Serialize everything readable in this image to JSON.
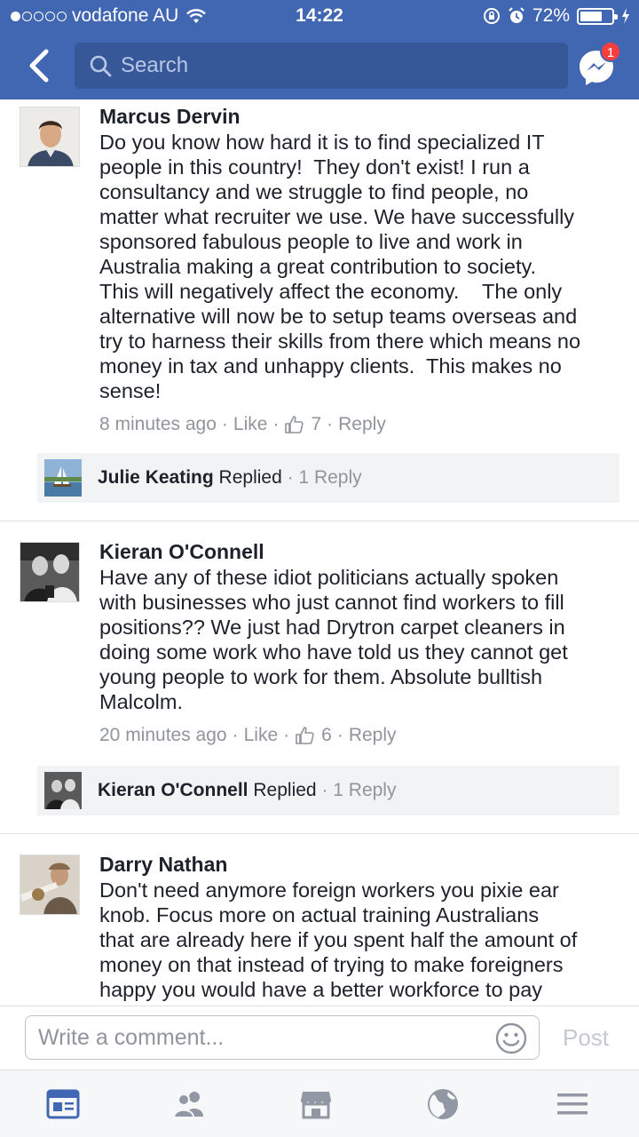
{
  "status_bar": {
    "carrier": "vodafone AU",
    "time": "14:22",
    "battery": "72%",
    "battery_level": 0.72,
    "signal_bars": 1
  },
  "header": {
    "search_placeholder": "Search",
    "messenger_badge": "1"
  },
  "comments": [
    {
      "author": "Marcus Dervin",
      "text": "Do you know how hard it is to find specialized IT\npeople in this country!  They don't exist! I run a\nconsultancy and we struggle to find people, no\nmatter what recruiter we use. We have successfully\nsponsored fabulous people to live and work in\nAustralia making a great contribution to society.\nThis will negatively affect the economy.    The only\nalternative will now be to setup teams overseas and\ntry to harness their skills from there which means no\nmoney in tax and unhappy clients.  This makes no\nsense!",
      "time": "8 minutes ago",
      "like_label": "Like",
      "like_count": "7",
      "reply_label": "Reply",
      "replied": {
        "name": "Julie Keating",
        "replied_label": "Replied",
        "count": "1 Reply"
      }
    },
    {
      "author": "Kieran O'Connell",
      "text": "Have any of these idiot politicians actually spoken\nwith businesses who just cannot find workers to fill\npositions?? We just had Drytron carpet cleaners in\ndoing some work who have told us they cannot get\nyoung people to work for them. Absolute bulltish\nMalcolm.",
      "time": "20 minutes ago",
      "like_label": "Like",
      "like_count": "6",
      "reply_label": "Reply",
      "replied": {
        "name": "Kieran O'Connell",
        "replied_label": "Replied",
        "count": "1 Reply"
      }
    },
    {
      "author": "Darry Nathan",
      "text": "Don't need anymore foreign workers you pixie ear\nknob. Focus more on actual training Australians\nthat are already here if you spent half the amount of\nmoney on that instead of trying to make foreigners\nhappy you would have a better workforce to pay\npayable #tax"
    }
  ],
  "composer": {
    "placeholder": "Write a comment...",
    "post_label": "Post"
  },
  "colors": {
    "brand": "#4267b2",
    "search_bg": "#365899",
    "meta": "#90949c",
    "active_tab": "#4267b2",
    "inactive_tab": "#9197a3"
  },
  "tabs": [
    {
      "icon": "news-feed-icon",
      "active": true
    },
    {
      "icon": "friends-icon",
      "active": false
    },
    {
      "icon": "marketplace-icon",
      "active": false
    },
    {
      "icon": "globe-icon",
      "active": false
    },
    {
      "icon": "menu-icon",
      "active": false
    }
  ]
}
